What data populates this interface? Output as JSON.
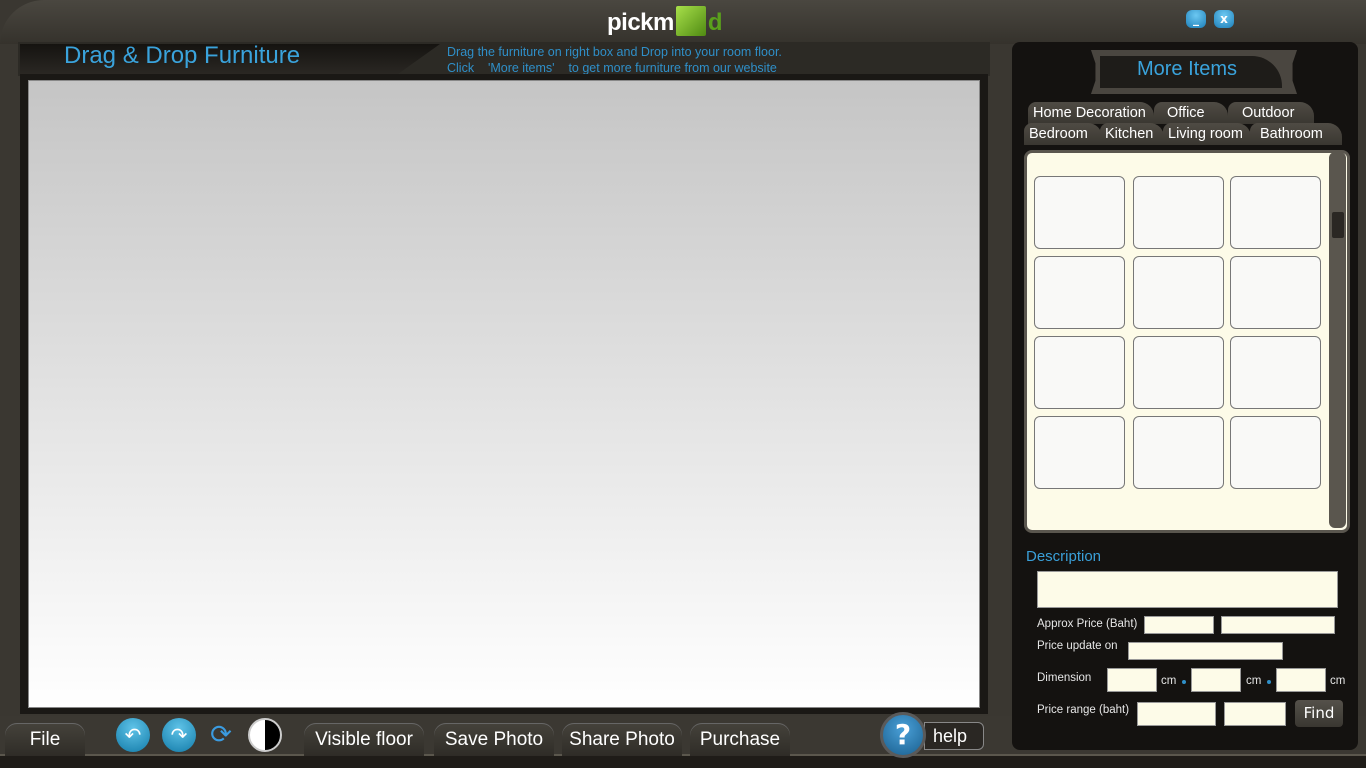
{
  "app": {
    "logo": "pickm3d",
    "logo_prefix": "pickm",
    "logo_suffix": "d"
  },
  "window": {
    "minimize": "_",
    "close": "x"
  },
  "header": {
    "title": "Drag & Drop Furniture",
    "hint_line1": "Drag the furniture on right box and Drop into your room floor.",
    "hint_line2": "Click    'More items'    to get more furniture from our website"
  },
  "toolbar": {
    "file": "File",
    "visible_floor": "Visible floor",
    "save_photo": "Save Photo",
    "share_photo": "Share Photo",
    "purchase": "Purchase",
    "help_q": "?",
    "help": "help"
  },
  "panel": {
    "more_items": "More Items",
    "tabs_row1": [
      "Home Decoration",
      "Office",
      "Outdoor"
    ],
    "tabs_row2": [
      "Bedroom",
      "Kitchen",
      "Living room",
      "Bathroom"
    ]
  },
  "details": {
    "description": "Description",
    "approx_price": "Approx Price (Baht)",
    "price_update": "Price update on",
    "dimension": "Dimension",
    "unit": "cm",
    "price_range": "Price range (baht)",
    "find": "Find"
  }
}
